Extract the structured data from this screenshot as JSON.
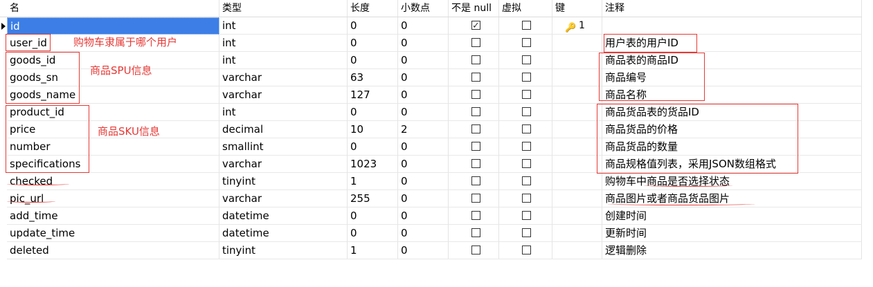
{
  "columns": [
    "名",
    "类型",
    "长度",
    "小数点",
    "不是 null",
    "虚拟",
    "键",
    "注释"
  ],
  "rows": [
    {
      "name": "id",
      "type": "int",
      "length": "0",
      "decimal": "0",
      "notnull": true,
      "virtual": false,
      "key": "1",
      "comment": ""
    },
    {
      "name": "user_id",
      "type": "int",
      "length": "0",
      "decimal": "0",
      "notnull": false,
      "virtual": false,
      "key": "",
      "comment": "用户表的用户ID"
    },
    {
      "name": "goods_id",
      "type": "int",
      "length": "0",
      "decimal": "0",
      "notnull": false,
      "virtual": false,
      "key": "",
      "comment": "商品表的商品ID"
    },
    {
      "name": "goods_sn",
      "type": "varchar",
      "length": "63",
      "decimal": "0",
      "notnull": false,
      "virtual": false,
      "key": "",
      "comment": "商品编号"
    },
    {
      "name": "goods_name",
      "type": "varchar",
      "length": "127",
      "decimal": "0",
      "notnull": false,
      "virtual": false,
      "key": "",
      "comment": "商品名称"
    },
    {
      "name": "product_id",
      "type": "int",
      "length": "0",
      "decimal": "0",
      "notnull": false,
      "virtual": false,
      "key": "",
      "comment": "商品货品表的货品ID"
    },
    {
      "name": "price",
      "type": "decimal",
      "length": "10",
      "decimal": "2",
      "notnull": false,
      "virtual": false,
      "key": "",
      "comment": "商品货品的价格"
    },
    {
      "name": "number",
      "type": "smallint",
      "length": "0",
      "decimal": "0",
      "notnull": false,
      "virtual": false,
      "key": "",
      "comment": "商品货品的数量"
    },
    {
      "name": "specifications",
      "type": "varchar",
      "length": "1023",
      "decimal": "0",
      "notnull": false,
      "virtual": false,
      "key": "",
      "comment": "商品规格值列表，采用JSON数组格式"
    },
    {
      "name": "checked",
      "type": "tinyint",
      "length": "1",
      "decimal": "0",
      "notnull": false,
      "virtual": false,
      "key": "",
      "comment": "购物车中商品是否选择状态"
    },
    {
      "name": "pic_url",
      "type": "varchar",
      "length": "255",
      "decimal": "0",
      "notnull": false,
      "virtual": false,
      "key": "",
      "comment": "商品图片或者商品货品图片"
    },
    {
      "name": "add_time",
      "type": "datetime",
      "length": "0",
      "decimal": "0",
      "notnull": false,
      "virtual": false,
      "key": "",
      "comment": "创建时间"
    },
    {
      "name": "update_time",
      "type": "datetime",
      "length": "0",
      "decimal": "0",
      "notnull": false,
      "virtual": false,
      "key": "",
      "comment": "更新时间"
    },
    {
      "name": "deleted",
      "type": "tinyint",
      "length": "1",
      "decimal": "0",
      "notnull": false,
      "virtual": false,
      "key": "",
      "comment": "逻辑删除"
    }
  ],
  "annotations": {
    "user_note": "购物车隶属于哪个用户",
    "spu_note": "商品SPU信息",
    "sku_note": "商品SKU信息"
  },
  "colors": {
    "selection": "#3c7ee6",
    "annotation": "#e53935",
    "key": "#d6a01c"
  },
  "icons": {
    "key": "key-icon",
    "row_marker": "current-row-arrow-icon"
  }
}
